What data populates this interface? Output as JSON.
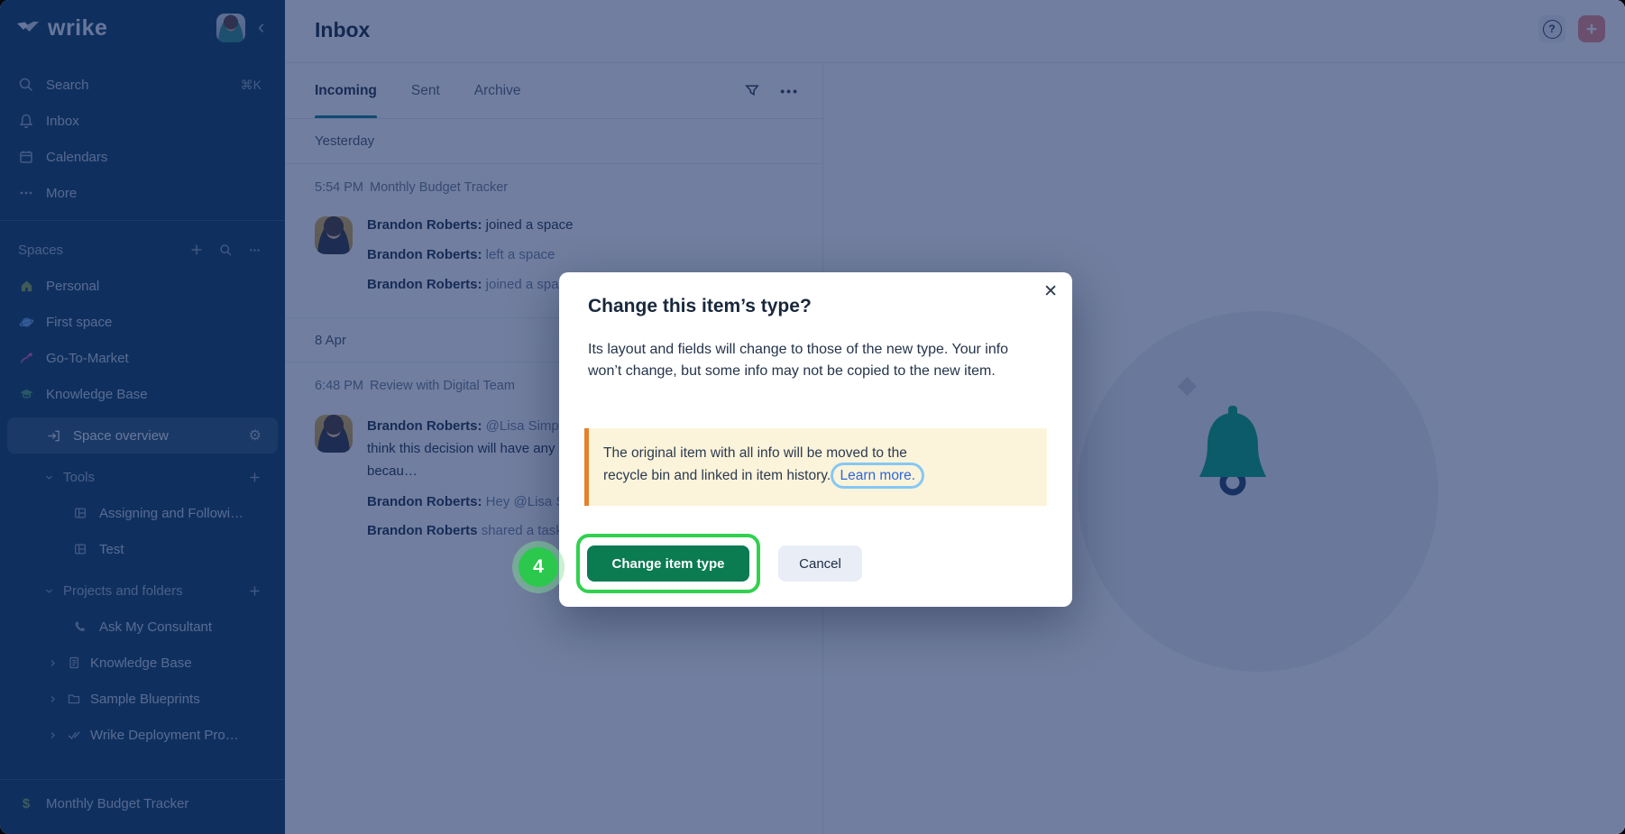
{
  "sidebar": {
    "logo_text": "wrike",
    "collapse_glyph": "‹",
    "nav": [
      {
        "label": "Search",
        "shortcut": "⌘K"
      },
      {
        "label": "Inbox"
      },
      {
        "label": "Calendars"
      },
      {
        "label": "More"
      }
    ],
    "spaces_header": {
      "label": "Spaces"
    },
    "spaces": [
      {
        "label": "Personal"
      },
      {
        "label": "First space"
      },
      {
        "label": "Go-To-Market"
      },
      {
        "label": "Knowledge Base"
      }
    ],
    "selected": {
      "label": "Space overview",
      "gear_glyph": "⚙"
    },
    "groups": [
      {
        "label": "Tools",
        "items": [
          {
            "label": "Assigning and Followi…"
          },
          {
            "label": "Test"
          }
        ]
      },
      {
        "label": "Projects and folders",
        "items": [
          {
            "label": "Ask My Consultant"
          },
          {
            "label": "Knowledge Base"
          },
          {
            "label": "Sample Blueprints"
          },
          {
            "label": "Wrike Deployment Pro…"
          }
        ]
      }
    ],
    "pinned": {
      "label": "Monthly Budget Tracker",
      "dollar_glyph": "$"
    }
  },
  "header": {
    "title": "Inbox",
    "help_glyph": "?",
    "plus_glyph": "+"
  },
  "inbox": {
    "tabs": [
      {
        "label": "Incoming"
      },
      {
        "label": "Sent"
      },
      {
        "label": "Archive"
      }
    ],
    "dots_glyph": "•••",
    "groups": [
      {
        "date": "Yesterday",
        "item": {
          "time": "5:54 PM",
          "title": "Monthly Budget Tracker",
          "messages": [
            {
              "author": "Brandon Roberts:",
              "text": "joined a space"
            },
            {
              "author": "Brandon Roberts:",
              "text": "left a space"
            },
            {
              "author": "Brandon Roberts:",
              "text": "joined a spa"
            }
          ]
        }
      },
      {
        "date": "8 Apr",
        "item": {
          "time": "6:48 PM",
          "title": "Review with Digital Team",
          "messages": [
            {
              "author": "Brandon Roberts:",
              "text": "@Lisa Simps",
              "line2": "think this decision will have any",
              "line3": "becau…"
            },
            {
              "author": "Brandon Roberts:",
              "text": "Hey @Lisa S"
            },
            {
              "author": "Brandon Roberts",
              "text": "shared a task"
            }
          ]
        }
      }
    ]
  },
  "modal": {
    "title": "Change this item’s type?",
    "body": "Its layout and fields will change to those of the new type. Your info won’t change, but some info may not be copied to the new item.",
    "warning_line1": "The original item with all info will be moved to the",
    "warning_line2": "recycle bin and linked in item history.",
    "learn_more": "Learn more.",
    "primary_button": "Change item type",
    "cancel_button": "Cancel",
    "close_glyph": "✕"
  },
  "annotation": {
    "step_number": "4"
  },
  "colors": {
    "sidebar_bg": "#0a3c5f",
    "dim_overlay": "rgba(18,40,95,0.60)",
    "tab_active_underline": "#0e7f8d",
    "primary_button_green": "#0b7b52",
    "annotation_green": "#31d14f",
    "badge_green": "#2cc84d",
    "warning_bg": "#fcf4da",
    "warning_border_orange": "#e5812c",
    "link_blue": "#2c66d9",
    "pill_outline_blue": "#87c7f3",
    "plus_button_pink": "#f08984",
    "empty_bell_green": "#00a87c"
  }
}
